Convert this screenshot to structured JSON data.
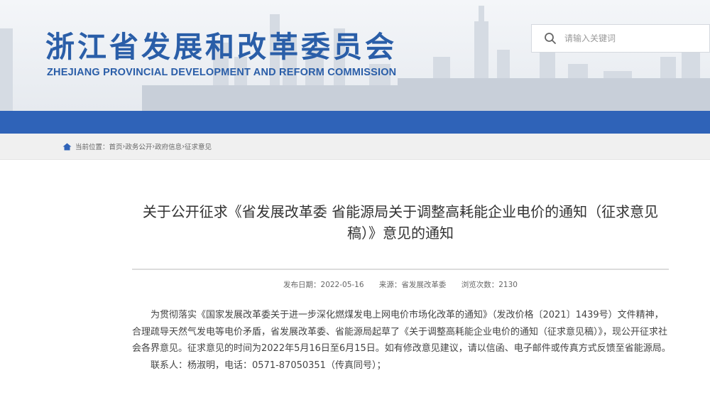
{
  "header": {
    "title_cn": "浙江省发展和改革委员会",
    "title_en": "ZHEJIANG PROVINCIAL DEVELOPMENT AND REFORM COMMISSION"
  },
  "search": {
    "placeholder": "请输入关键词",
    "icon": "search-icon"
  },
  "breadcrumb": {
    "icon": "home-icon",
    "prefix": "当前位置：",
    "items": [
      "首页",
      "政务公开",
      "政府信息",
      "征求意见"
    ],
    "separator": " › "
  },
  "article": {
    "title": "关于公开征求《省发展改革委 省能源局关于调整高耗能企业电价的通知（征求意见稿）》意见的通知",
    "meta": {
      "date": "发布日期：2022-05-16",
      "source": "来源：省发展改革委",
      "views": "浏览次数：2130"
    },
    "paragraph": "为贯彻落实《国家发展改革委关于进一步深化燃煤发电上网电价市场化改革的通知》（发改价格〔2021〕1439号）文件精神，合理疏导天然气发电等电价矛盾，省发展改革委、省能源局起草了《关于调整高耗能企业电价的通知（征求意见稿）》，现公开征求社会各界意见。征求意见的时间为2022年5月16日至6月15日。如有修改意见建议，请以信函、电子邮件或传真方式反馈至省能源局。",
    "contact": "联系人：杨淑明，电话：0571-87050351（传真同号）；"
  },
  "colors": {
    "brand_blue": "#2a5ea8",
    "band_blue": "#2f63b8"
  }
}
